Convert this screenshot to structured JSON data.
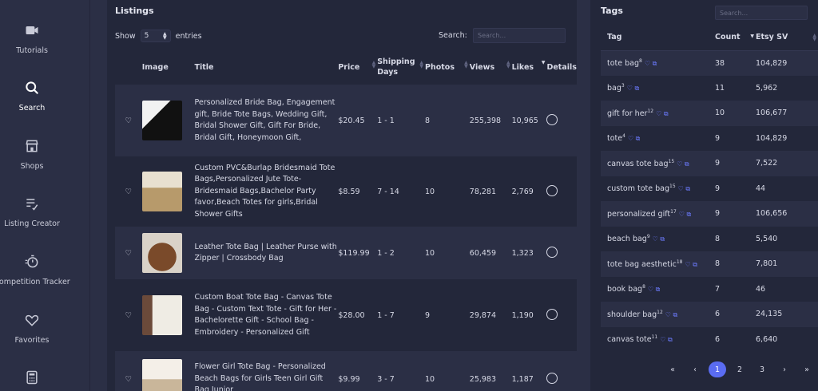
{
  "sidebar": {
    "items": [
      {
        "label": "Tutorials",
        "icon": "video-camera-icon"
      },
      {
        "label": "Search",
        "icon": "search-icon",
        "active": true
      },
      {
        "label": "Shops",
        "icon": "store-icon"
      },
      {
        "label": "Listing Creator",
        "icon": "edit-list-icon"
      },
      {
        "label": "Competition Tracker",
        "icon": "stopwatch-icon"
      },
      {
        "label": "Favorites",
        "icon": "heart-icon"
      },
      {
        "label": "",
        "icon": "calculator-icon"
      }
    ]
  },
  "listings": {
    "title": "Listings",
    "show_label": "Show",
    "entries_value": "5",
    "entries_label": "entries",
    "search_label": "Search:",
    "search_placeholder": "Search...",
    "columns": [
      "Image",
      "Title",
      "Price",
      "Shipping Days",
      "Photos",
      "Views",
      "Likes",
      "Details"
    ],
    "rows": [
      {
        "title": "Personalized Bride Bag, Engagement gift, Bride Tote Bags, Wedding Gift, Bridal Shower Gift, Gift For Bride, Bridal Gift, Honeymoon Gift,",
        "price": "$20.45",
        "shipping": "1 - 1",
        "photos": "8",
        "views": "255,398",
        "likes": "10,965",
        "thumb_colors": [
          "#f2f2f2",
          "#111111"
        ]
      },
      {
        "title": "Custom PVC&Burlap Bridesmaid Tote Bags,Personalized Jute Tote-Bridesmaid Bags,Bachelor Party favor,Beach Totes for girls,Bridal Shower Gifts",
        "price": "$8.59",
        "shipping": "7 - 14",
        "photos": "10",
        "views": "78,281",
        "likes": "2,769",
        "thumb_colors": [
          "#e8e0d0",
          "#b79a6b"
        ]
      },
      {
        "title": "Leather Tote Bag | Leather Purse with Zipper | Crossbody Bag",
        "price": "$119.99",
        "shipping": "1 - 2",
        "photos": "10",
        "views": "60,459",
        "likes": "1,323",
        "thumb_colors": [
          "#d9d2c8",
          "#7a4a2a"
        ]
      },
      {
        "title": "Custom Boat Tote Bag - Canvas Tote Bag - Custom Text Tote - Gift for Her - Bachelorette Gift - School Bag - Embroidery - Personalized Gift",
        "price": "$28.00",
        "shipping": "1 - 7",
        "photos": "9",
        "views": "29,874",
        "likes": "1,190",
        "thumb_colors": [
          "#6b4a3a",
          "#efece4"
        ]
      },
      {
        "title": "Flower Girl Tote Bag - Personalized Beach Bags for Girls Teen Girl Gift Bag Junior",
        "price": "$9.99",
        "shipping": "3 - 7",
        "photos": "10",
        "views": "25,983",
        "likes": "1,187",
        "thumb_colors": [
          "#f4efe8",
          "#c9b69a"
        ]
      }
    ]
  },
  "tags": {
    "title": "Tags",
    "search_placeholder": "Search...",
    "columns": [
      "Tag",
      "Count",
      "Etsy SV"
    ],
    "rows": [
      {
        "tag": "tote bag",
        "sup": "8",
        "count": "38",
        "sv": "104,829"
      },
      {
        "tag": "bag",
        "sup": "3",
        "count": "11",
        "sv": "5,962"
      },
      {
        "tag": "gift for her",
        "sup": "12",
        "count": "10",
        "sv": "106,677"
      },
      {
        "tag": "tote",
        "sup": "4",
        "count": "9",
        "sv": "104,829"
      },
      {
        "tag": "canvas tote bag",
        "sup": "15",
        "count": "9",
        "sv": "7,522"
      },
      {
        "tag": "custom tote bag",
        "sup": "15",
        "count": "9",
        "sv": "44"
      },
      {
        "tag": "personalized gift",
        "sup": "17",
        "count": "9",
        "sv": "106,656"
      },
      {
        "tag": "beach bag",
        "sup": "9",
        "count": "8",
        "sv": "5,540"
      },
      {
        "tag": "tote bag aesthetic",
        "sup": "18",
        "count": "8",
        "sv": "7,801"
      },
      {
        "tag": "book bag",
        "sup": "8",
        "count": "7",
        "sv": "46"
      },
      {
        "tag": "shoulder bag",
        "sup": "12",
        "count": "6",
        "sv": "24,135"
      },
      {
        "tag": "canvas tote",
        "sup": "11",
        "count": "6",
        "sv": "6,640"
      }
    ],
    "pagination": {
      "first": "«",
      "prev": "‹",
      "pages": [
        "1",
        "2",
        "3"
      ],
      "current": "1",
      "next": "›",
      "last": "»"
    }
  },
  "colors": {
    "accent": "#5a6cf2",
    "link": "#5d76e8",
    "panel": "#23273a",
    "row_alt": "#2b2f45"
  }
}
